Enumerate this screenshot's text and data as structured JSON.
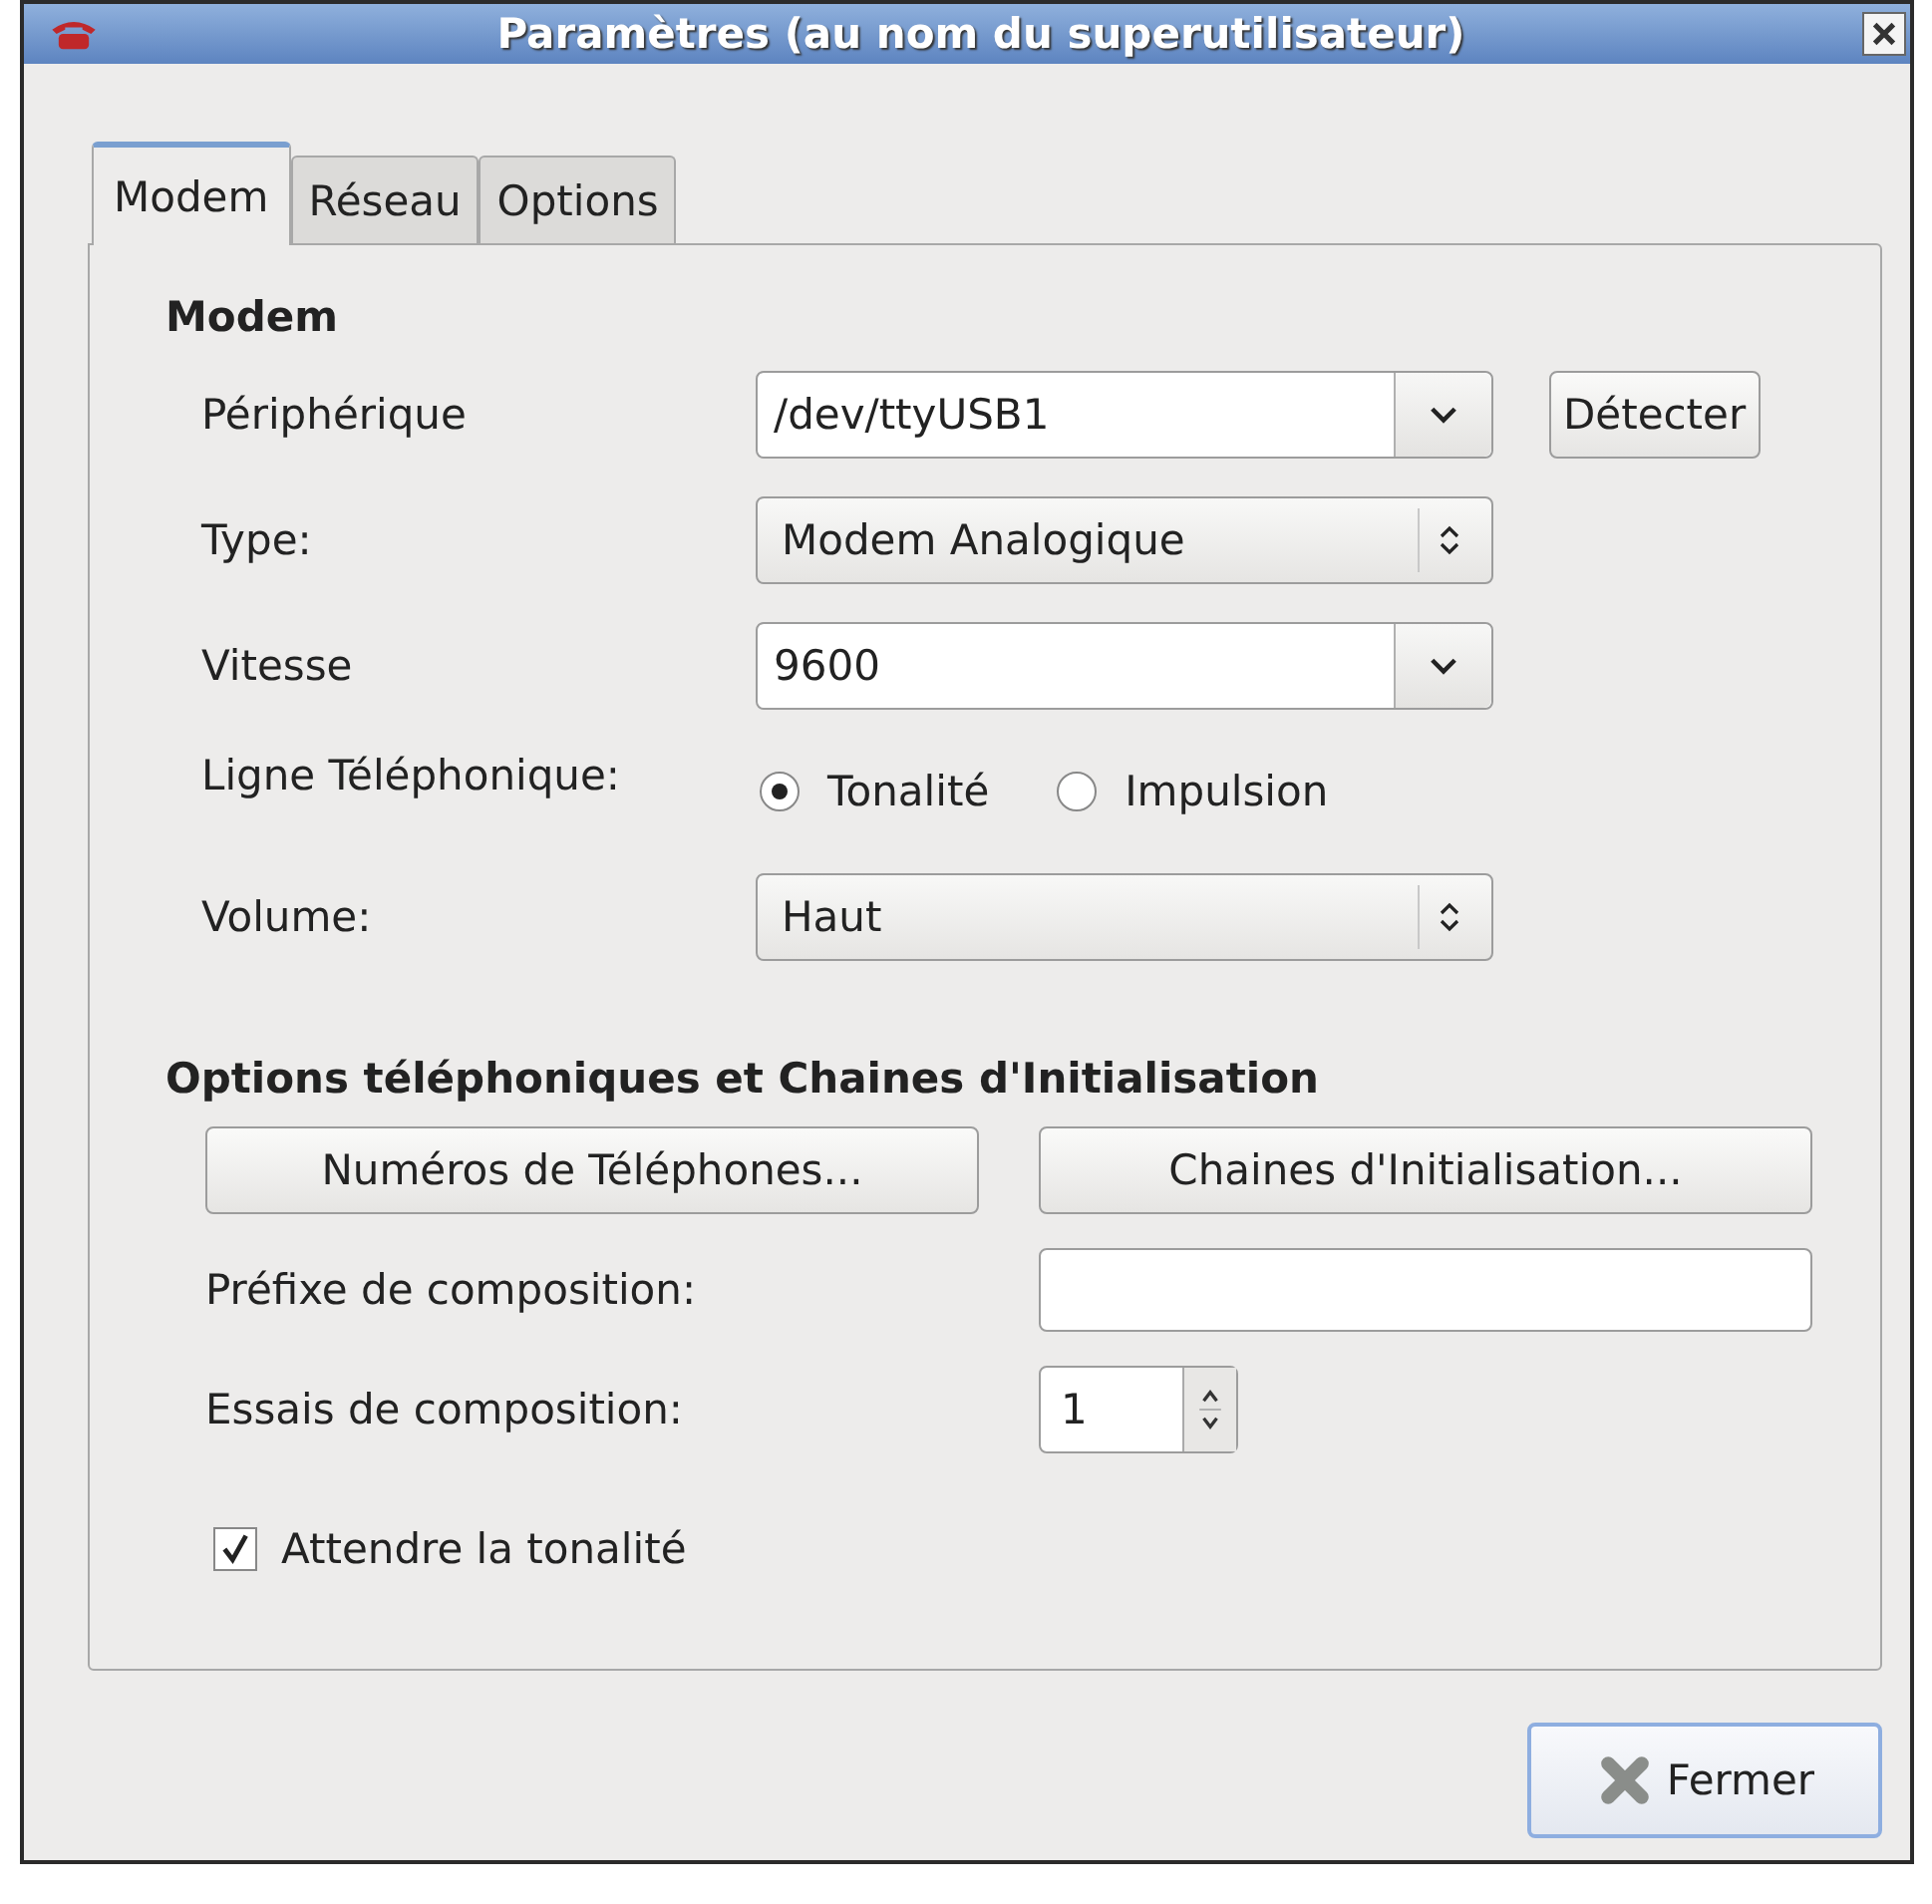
{
  "window": {
    "title": "Paramètres (au nom du superutilisateur)"
  },
  "tabs": [
    {
      "label": "Modem",
      "selected": true
    },
    {
      "label": "Réseau",
      "selected": false
    },
    {
      "label": "Options",
      "selected": false
    }
  ],
  "modem": {
    "heading": "Modem",
    "rows": [
      {
        "kind": "combo-entry",
        "label": "Périphérique",
        "value": "/dev/ttyUSB1",
        "button": {
          "label": "Détecter"
        }
      },
      {
        "kind": "combo",
        "label": "Type:",
        "value": "Modem Analogique"
      },
      {
        "kind": "combo-entry",
        "label": "Vitesse",
        "value": "9600"
      },
      {
        "kind": "radio",
        "label": "Ligne Téléphonique:",
        "options": [
          {
            "label": "Tonalité",
            "selected": true
          },
          {
            "label": "Impulsion",
            "selected": false
          }
        ]
      },
      {
        "kind": "combo",
        "label": "Volume:",
        "value": "Haut"
      }
    ]
  },
  "phone_options": {
    "heading": "Options téléphoniques et Chaines d'Initialisation",
    "buttons": [
      {
        "label": "Numéros de Téléphones..."
      },
      {
        "label": "Chaines d'Initialisation..."
      }
    ],
    "prefix": {
      "label": "Préfixe de composition:"
    },
    "retries": {
      "label": "Essais de composition:",
      "value": "1"
    },
    "wait_tone": {
      "label": "Attendre la tonalité",
      "checked": true
    }
  },
  "footer": {
    "close_button": {
      "label": "Fermer"
    }
  }
}
